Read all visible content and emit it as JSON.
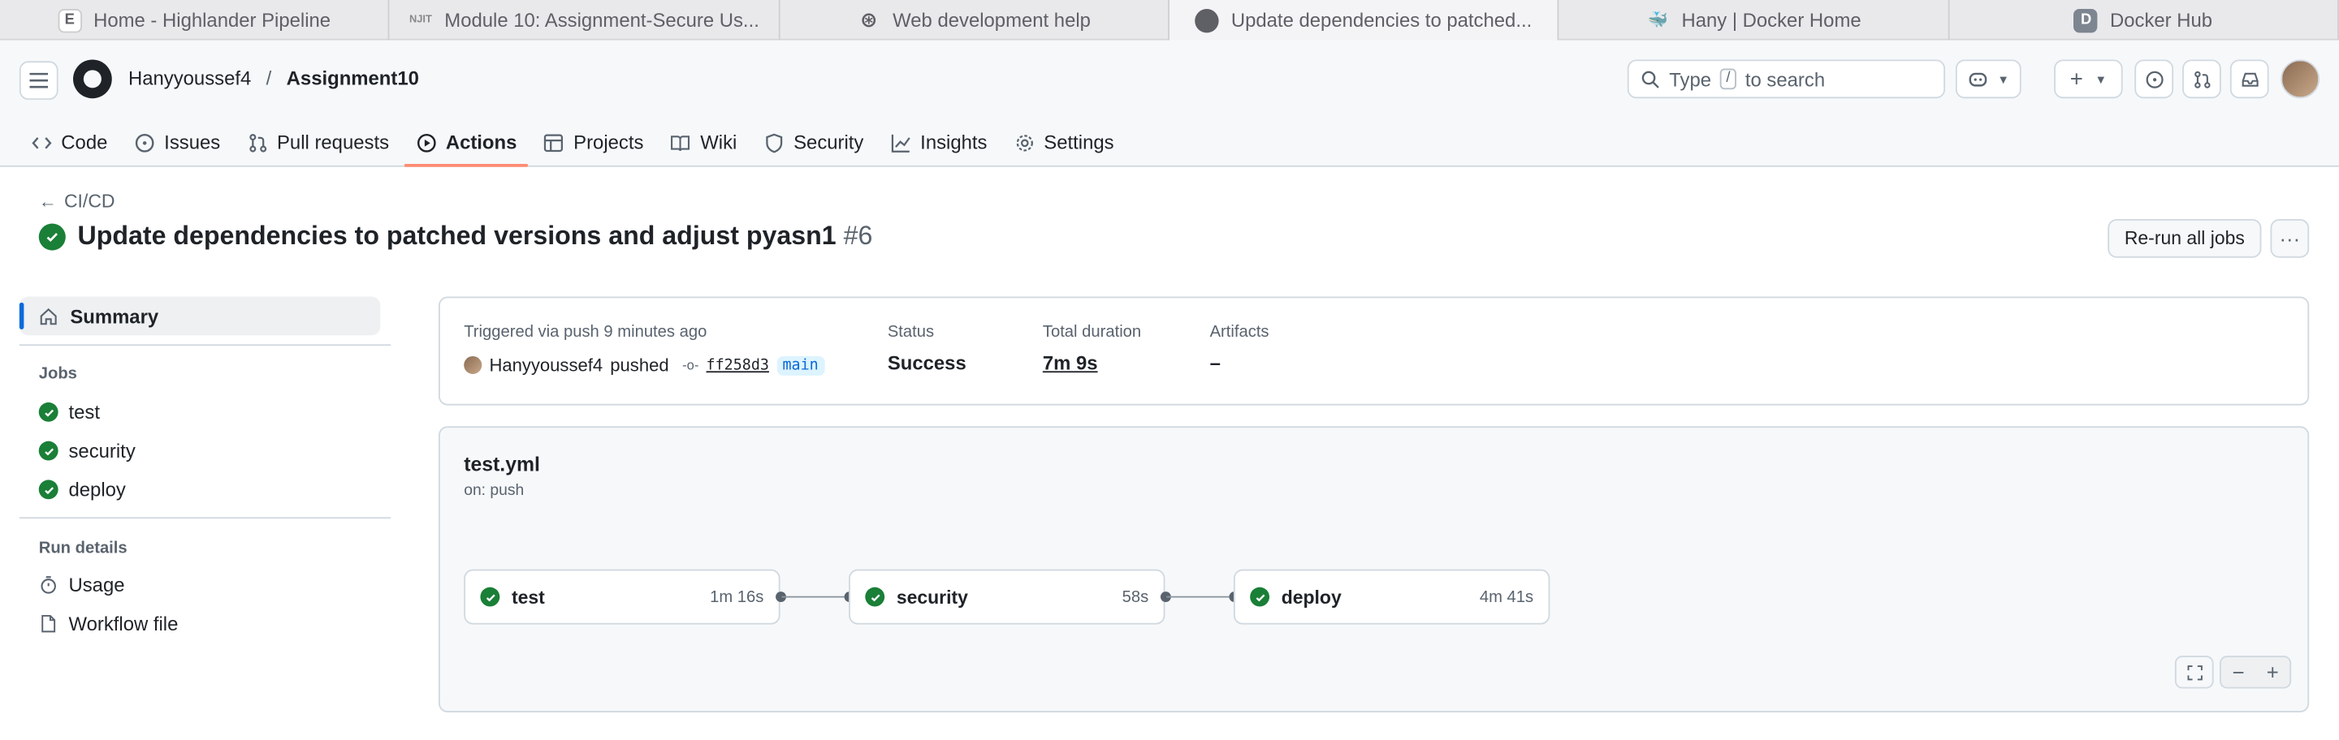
{
  "browser": {
    "tabs": [
      {
        "title": "Home - Highlander Pipeline",
        "fav_text": "E",
        "fav_color": "#ffffff"
      },
      {
        "title": "Module 10: Assignment-Secure Us...",
        "fav_text": "NJIT",
        "fav_color": "#e9e9ec"
      },
      {
        "title": "Web development help",
        "fav_text": "⊛",
        "fav_color": "#e9e9ec"
      },
      {
        "title": "Update dependencies to patched...",
        "fav_text": "●",
        "fav_color": "#e9e9ec"
      },
      {
        "title": "Hany | Docker Home",
        "fav_text": "🐳",
        "fav_color": "#e9e9ec"
      },
      {
        "title": "Docker Hub",
        "fav_text": "D",
        "fav_color": "#7d8590"
      }
    ]
  },
  "header": {
    "owner": "Hanyyoussef4",
    "separator": "/",
    "repo": "Assignment10",
    "search_type": "Type",
    "search_key": "/",
    "search_suffix": "to search"
  },
  "repo_nav": {
    "items": [
      {
        "label": "Code",
        "icon": "code-icon"
      },
      {
        "label": "Issues",
        "icon": "issue-icon"
      },
      {
        "label": "Pull requests",
        "icon": "pull-request-icon"
      },
      {
        "label": "Actions",
        "icon": "play-icon"
      },
      {
        "label": "Projects",
        "icon": "table-icon"
      },
      {
        "label": "Wiki",
        "icon": "book-icon"
      },
      {
        "label": "Security",
        "icon": "shield-icon"
      },
      {
        "label": "Insights",
        "icon": "graph-icon"
      },
      {
        "label": "Settings",
        "icon": "gear-icon"
      }
    ],
    "active": "Actions"
  },
  "run": {
    "back_label": "CI/CD",
    "title": "Update dependencies to patched versions and adjust pyasn1",
    "number": "#6",
    "rerun_label": "Re-run all jobs",
    "more_label": "···"
  },
  "sidebar": {
    "summary_label": "Summary",
    "jobs_heading": "Jobs",
    "jobs": [
      "test",
      "security",
      "deploy"
    ],
    "run_details_heading": "Run details",
    "details": [
      {
        "label": "Usage",
        "icon": "stopwatch-icon"
      },
      {
        "label": "Workflow file",
        "icon": "file-icon"
      }
    ]
  },
  "summary": {
    "trigger_label": "Triggered via push 9 minutes ago",
    "actor": "Hanyyoussef4",
    "action": "pushed",
    "sha": "ff258d3",
    "branch": "main",
    "status_label": "Status",
    "status_value": "Success",
    "duration_label": "Total duration",
    "duration_value": "7m 9s",
    "artifacts_label": "Artifacts",
    "artifacts_value": "–"
  },
  "workflow": {
    "file": "test.yml",
    "trigger": "on: push",
    "jobs": [
      {
        "name": "test",
        "duration": "1m 16s"
      },
      {
        "name": "security",
        "duration": "58s"
      },
      {
        "name": "deploy",
        "duration": "4m 41s"
      }
    ]
  },
  "colors": {
    "success": "#1a7f37",
    "accent": "#fd8c73",
    "link": "#0969da"
  }
}
